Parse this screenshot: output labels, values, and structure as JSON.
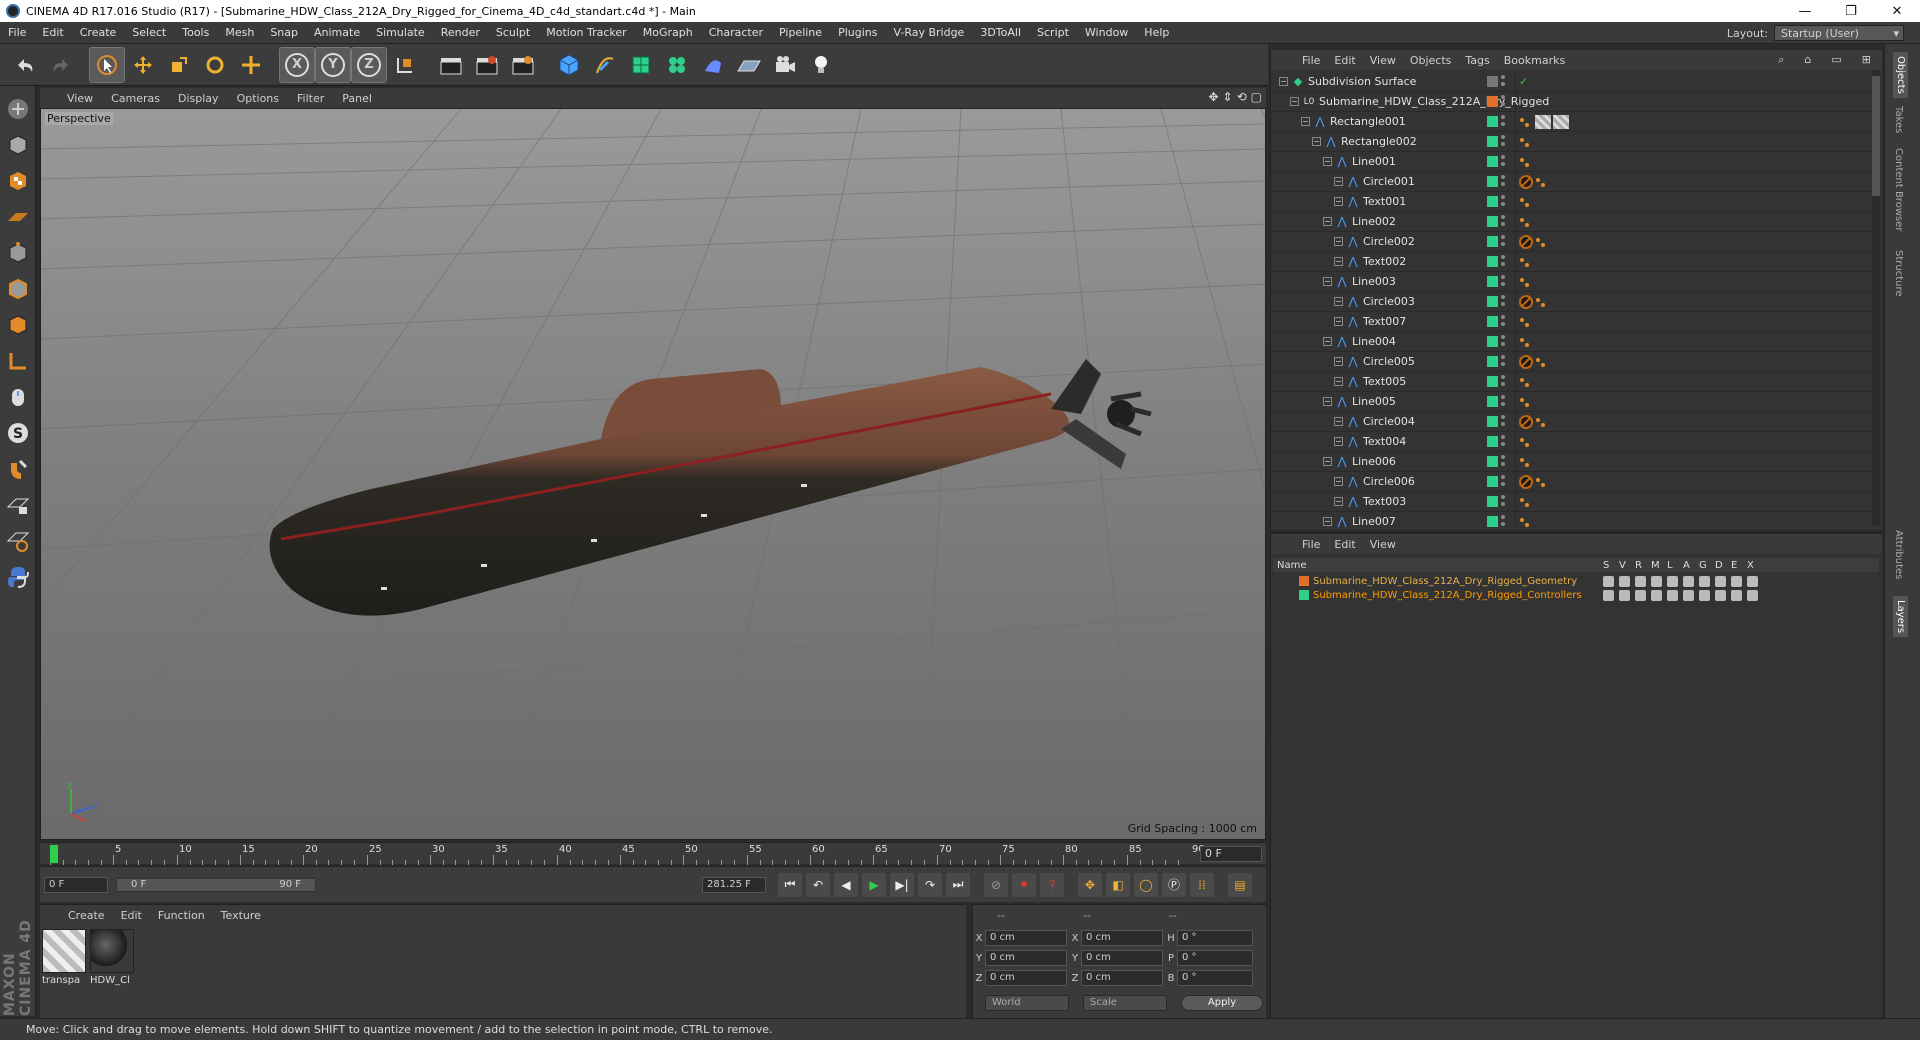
{
  "window": {
    "title": "CINEMA 4D R17.016 Studio (R17) - [Submarine_HDW_Class_212A_Dry_Rigged_for_Cinema_4D_c4d_standart.c4d *] - Main",
    "minimize": "—",
    "restore": "❐",
    "close": "✕"
  },
  "menubar": {
    "items": [
      "File",
      "Edit",
      "Create",
      "Select",
      "Tools",
      "Mesh",
      "Snap",
      "Animate",
      "Simulate",
      "Render",
      "Sculpt",
      "Motion Tracker",
      "MoGraph",
      "Character",
      "Pipeline",
      "Plugins",
      "V-Ray Bridge",
      "3DToAll",
      "Script",
      "Window",
      "Help"
    ],
    "layout_label": "Layout:",
    "layout_value": "Startup (User)"
  },
  "toolbar": {
    "axis_x": "X",
    "axis_y": "Y",
    "axis_z": "Z"
  },
  "viewport": {
    "menu": [
      "View",
      "Cameras",
      "Display",
      "Options",
      "Filter",
      "Panel"
    ],
    "camera_label": "Perspective",
    "grid_spacing": "Grid Spacing : 1000 cm"
  },
  "timeline": {
    "ticks": [
      "0",
      "5",
      "10",
      "15",
      "20",
      "25",
      "30",
      "35",
      "40",
      "45",
      "50",
      "55",
      "60",
      "65",
      "70",
      "75",
      "80",
      "85",
      "90"
    ],
    "current_frame": "0 F"
  },
  "transport": {
    "start_frame": "0 F",
    "range_start": "0 F",
    "range_end": "90 F",
    "fps_field": "281.25 F"
  },
  "material_manager": {
    "menu": [
      "Create",
      "Edit",
      "Function",
      "Texture"
    ],
    "materials": [
      {
        "label": "transpa"
      },
      {
        "label": "HDW_Cl"
      }
    ]
  },
  "coordinates": {
    "headers": [
      "--",
      "--",
      "--"
    ],
    "rows": [
      {
        "a1": "X",
        "v1": "0 cm",
        "a2": "X",
        "v2": "0 cm",
        "a3": "H",
        "v3": "0 °"
      },
      {
        "a1": "Y",
        "v1": "0 cm",
        "a2": "Y",
        "v2": "0 cm",
        "a3": "P",
        "v3": "0 °"
      },
      {
        "a1": "Z",
        "v1": "0 cm",
        "a2": "Z",
        "v2": "0 cm",
        "a3": "B",
        "v3": "0 °"
      }
    ],
    "mode": "World",
    "scale": "Scale",
    "apply": "Apply"
  },
  "object_manager": {
    "menu": [
      "File",
      "Edit",
      "View",
      "Objects",
      "Tags",
      "Bookmarks"
    ],
    "objects": [
      {
        "name": "Subdivision Surface",
        "depth": 0,
        "icon": "subdiv"
      },
      {
        "name": "Submarine_HDW_Class_212A_Dry_Rigged",
        "depth": 1,
        "icon": "null"
      },
      {
        "name": "Rectangle001",
        "depth": 2,
        "icon": "spline"
      },
      {
        "name": "Rectangle002",
        "depth": 3,
        "icon": "spline"
      },
      {
        "name": "Line001",
        "depth": 4,
        "icon": "spline"
      },
      {
        "name": "Circle001",
        "depth": 5,
        "icon": "spline"
      },
      {
        "name": "Text001",
        "depth": 5,
        "icon": "spline"
      },
      {
        "name": "Line002",
        "depth": 4,
        "icon": "spline"
      },
      {
        "name": "Circle002",
        "depth": 5,
        "icon": "spline"
      },
      {
        "name": "Text002",
        "depth": 5,
        "icon": "spline"
      },
      {
        "name": "Line003",
        "depth": 4,
        "icon": "spline"
      },
      {
        "name": "Circle003",
        "depth": 5,
        "icon": "spline"
      },
      {
        "name": "Text007",
        "depth": 5,
        "icon": "spline"
      },
      {
        "name": "Line004",
        "depth": 4,
        "icon": "spline"
      },
      {
        "name": "Circle005",
        "depth": 5,
        "icon": "spline"
      },
      {
        "name": "Text005",
        "depth": 5,
        "icon": "spline"
      },
      {
        "name": "Line005",
        "depth": 4,
        "icon": "spline"
      },
      {
        "name": "Circle004",
        "depth": 5,
        "icon": "spline"
      },
      {
        "name": "Text004",
        "depth": 5,
        "icon": "spline"
      },
      {
        "name": "Line006",
        "depth": 4,
        "icon": "spline"
      },
      {
        "name": "Circle006",
        "depth": 5,
        "icon": "spline"
      },
      {
        "name": "Text003",
        "depth": 5,
        "icon": "spline"
      },
      {
        "name": "Line007",
        "depth": 4,
        "icon": "spline"
      }
    ]
  },
  "layer_manager": {
    "menu": [
      "File",
      "Edit",
      "View"
    ],
    "columns": [
      "Name",
      "S",
      "V",
      "R",
      "M",
      "L",
      "A",
      "G",
      "D",
      "E",
      "X"
    ],
    "layers": [
      {
        "name": "Submarine_HDW_Class_212A_Dry_Rigged_Geometry",
        "color": "#e0702a"
      },
      {
        "name": "Submarine_HDW_Class_212A_Dry_Rigged_Controllers",
        "color": "#2ecf8a"
      }
    ]
  },
  "side_tabs": [
    "Objects",
    "Takes",
    "Content Browser",
    "Structure",
    "Attributes",
    "Layers"
  ],
  "status": "Move: Click and drag to move elements. Hold down SHIFT to quantize movement / add to the selection in point mode, CTRL to remove.",
  "logo": "MAXON CINEMA 4D"
}
